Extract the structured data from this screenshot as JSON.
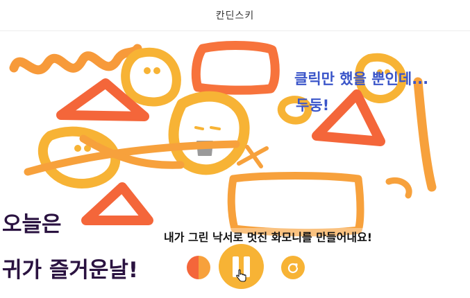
{
  "app": {
    "title": "칸딘스키"
  },
  "captions": {
    "click_line1": "클릭만 했을 뿐인데...",
    "click_line2": "두둥!",
    "today": "오늘은",
    "fun_day": "귀가 즐거운날!",
    "harmony": "내가 그린 낙서로 멋진 화모니를 만들어내요!"
  },
  "controls": {
    "color_icon": "half-circle-color-icon",
    "pause_icon": "pause-icon",
    "reset_icon": "refresh-icon",
    "cursor_icon": "hand-pointer-icon"
  },
  "colors": {
    "orange_red": "#f4663a",
    "orange": "#f7a13c",
    "yellow": "#f7b335",
    "blue_caption": "#3a55c9",
    "dark_caption": "#2a1240"
  }
}
